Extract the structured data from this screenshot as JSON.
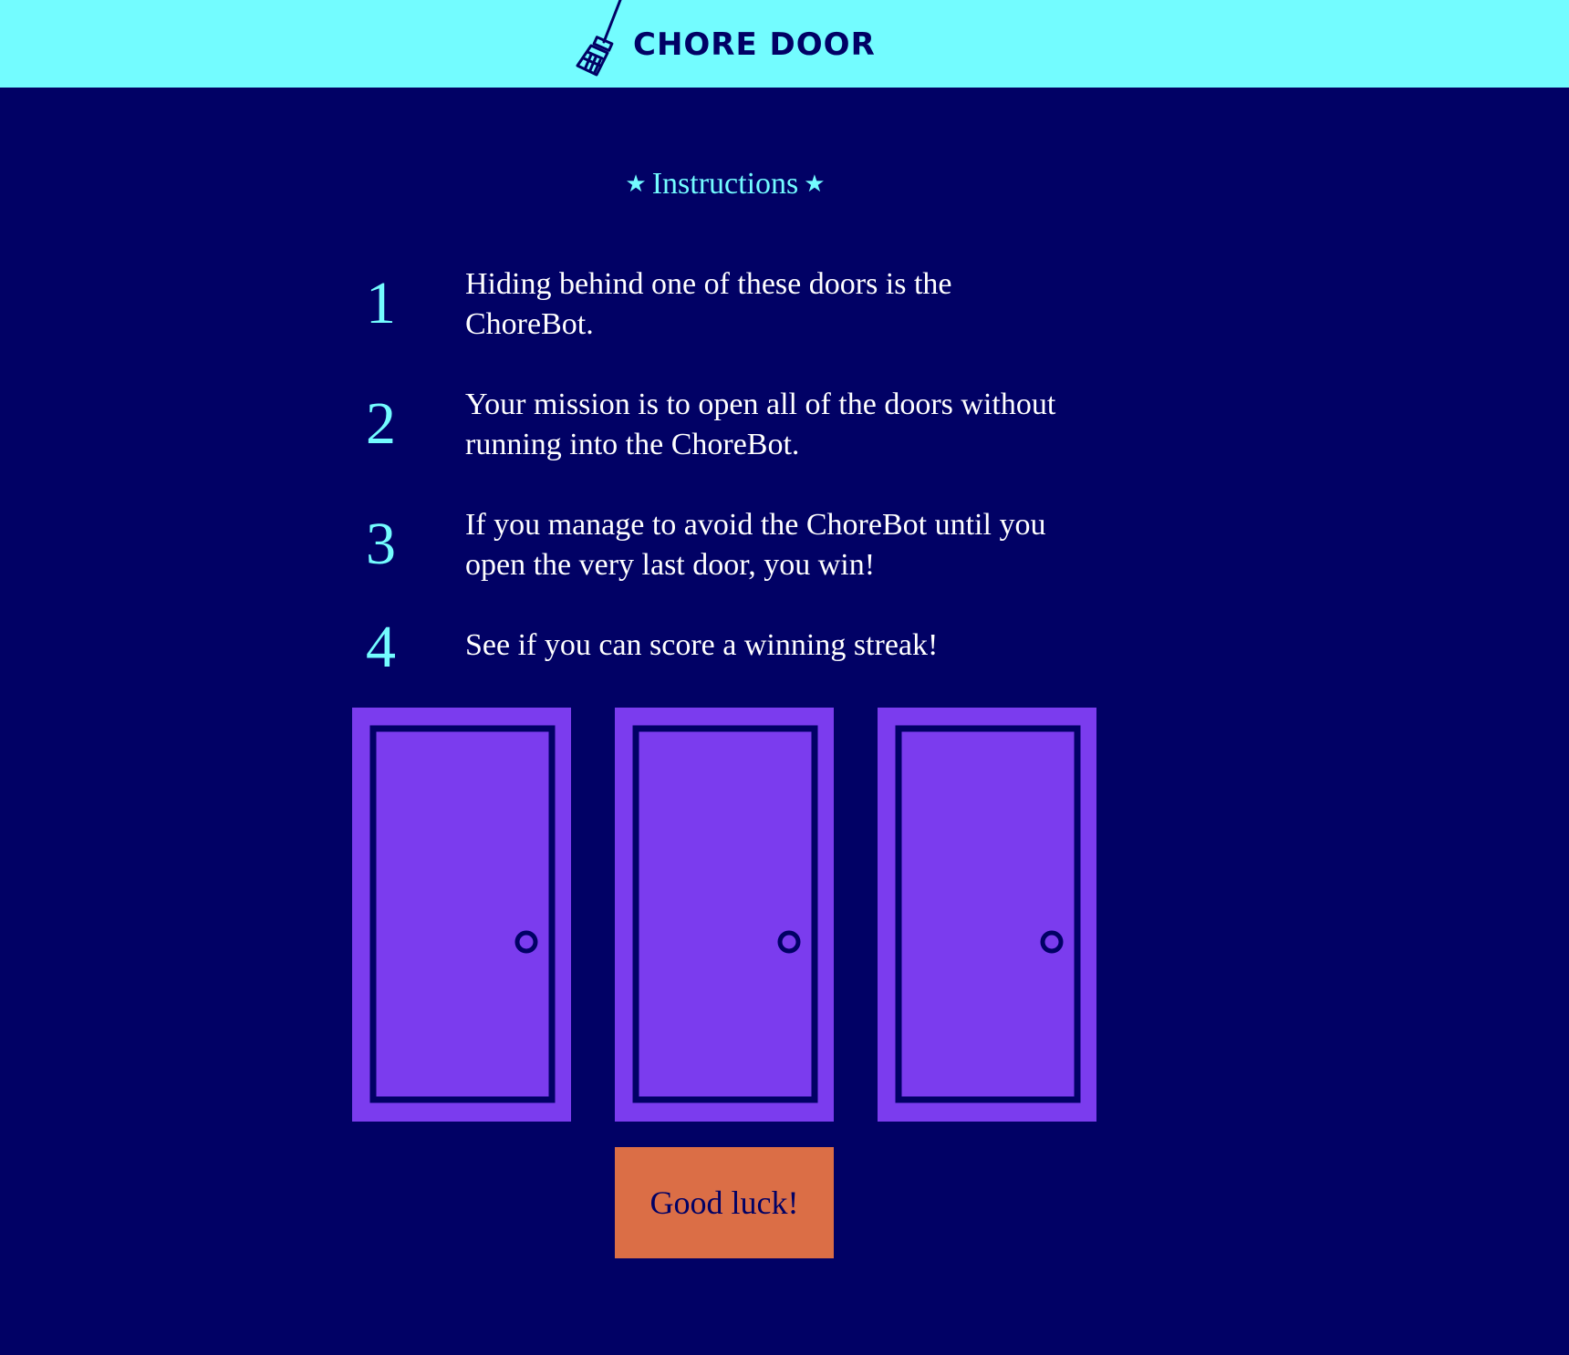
{
  "header": {
    "brand": "CHORE DOOR",
    "icon": "broom-icon"
  },
  "instructions": {
    "title": "Instructions",
    "star_glyph": "★",
    "steps": [
      {
        "number": "1",
        "text": "Hiding behind one of these doors is the ChoreBot."
      },
      {
        "number": "2",
        "text": "Your mission is to open all of the doors without running into the ChoreBot."
      },
      {
        "number": "3",
        "text": "If you manage to avoid the ChoreBot until you open the very last door, you win!"
      },
      {
        "number": "4",
        "text": "See if you can score a winning streak!"
      }
    ]
  },
  "doors": [
    {
      "state": "closed",
      "icon": "closed-door-icon"
    },
    {
      "state": "closed",
      "icon": "closed-door-icon"
    },
    {
      "state": "closed",
      "icon": "closed-door-icon"
    }
  ],
  "start_button": {
    "label": "Good luck!"
  },
  "colors": {
    "background": "#010165",
    "header": "#73fcff",
    "accent": "#73fcff",
    "door": "#7b3cee",
    "button": "#db6e46",
    "text": "#ffffff"
  }
}
